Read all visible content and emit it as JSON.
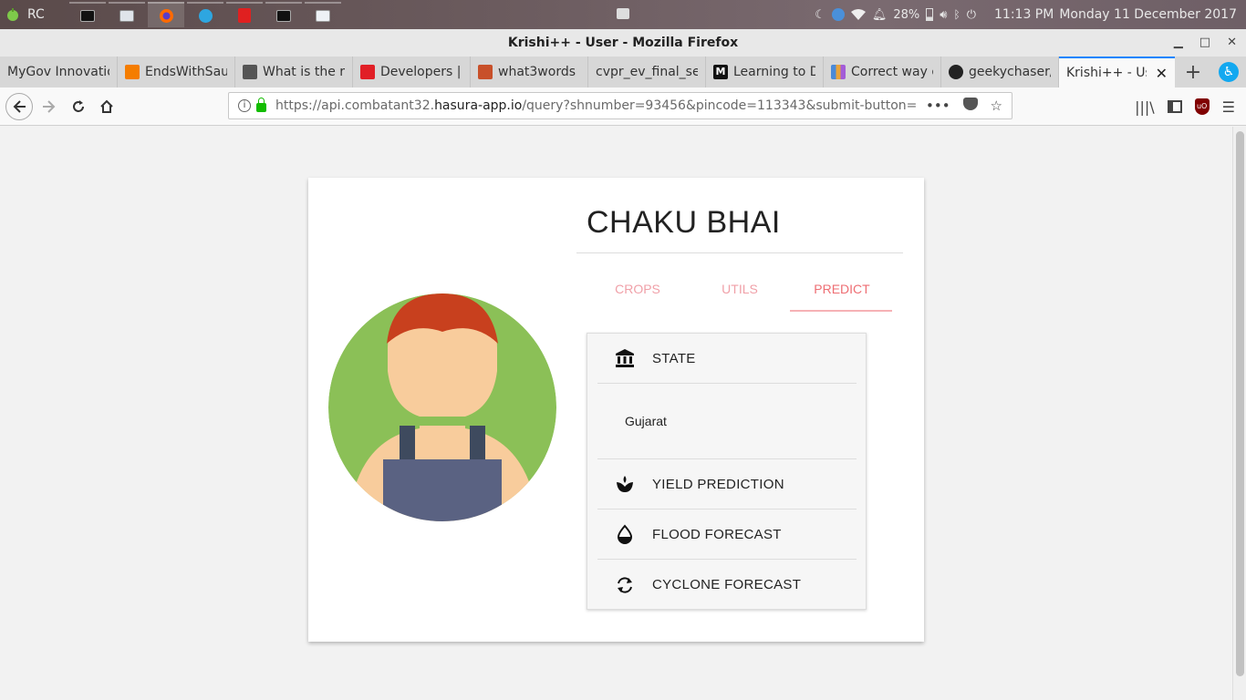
{
  "os_bar": {
    "launcher_label": "RC",
    "battery": "28%",
    "clock": "11:13 PM",
    "date": "Monday 11 December 2017"
  },
  "window": {
    "title": "Krishi++ - User - Mozilla Firefox"
  },
  "tabs": [
    {
      "title": "MyGov Innovation",
      "icon": "mygov-icon"
    },
    {
      "title": "EndsWithSau",
      "icon": "blogger-icon"
    },
    {
      "title": "What is the ri",
      "icon": "cube-icon"
    },
    {
      "title": "Developers |",
      "icon": "w3w-icon"
    },
    {
      "title": "what3words |",
      "icon": "w3w-icon"
    },
    {
      "title": "cvpr_ev_final_se",
      "icon": "doc-icon"
    },
    {
      "title": "Learning to D",
      "icon": "medium-icon"
    },
    {
      "title": "Correct way o",
      "icon": "chart-icon"
    },
    {
      "title": "geekychaser/",
      "icon": "github-icon"
    },
    {
      "title": "Krishi++ - Use",
      "icon": "page-icon",
      "active": true
    }
  ],
  "navbar": {
    "url_prefix": "https://api.combatant32.",
    "url_domain": "hasura-app.io",
    "url_suffix": "/query?shnumber=93456&pincode=113343&submit-button="
  },
  "profile": {
    "name": "CHAKU BHAI",
    "tabs": [
      "CROPS",
      "UTILS",
      "PREDICT"
    ],
    "active_tab": "PREDICT"
  },
  "predict_panel": {
    "header": "STATE",
    "state_value": "Gujarat",
    "items": [
      {
        "label": "YIELD PREDICTION",
        "icon": "seedling-icon"
      },
      {
        "label": "FLOOD FORECAST",
        "icon": "water-drop-icon"
      },
      {
        "label": "CYCLONE FORECAST",
        "icon": "cyclone-icon"
      }
    ]
  },
  "colors": {
    "accent": "#ee6e73",
    "avatar_bg": "#8bc057",
    "hair": "#c8401e",
    "skin": "#f8cc9c",
    "overalls": "#5a6282"
  }
}
